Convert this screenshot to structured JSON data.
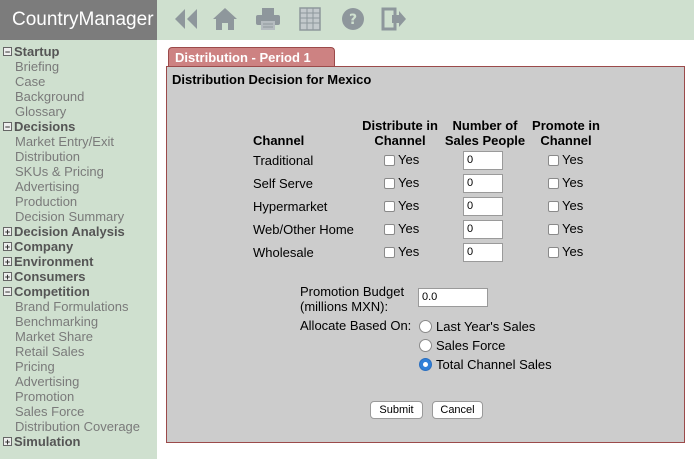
{
  "brand": "CountryManager",
  "toolbar": [
    {
      "name": "back-icon"
    },
    {
      "name": "home-icon"
    },
    {
      "name": "print-icon"
    },
    {
      "name": "spreadsheet-icon"
    },
    {
      "name": "help-icon"
    },
    {
      "name": "exit-icon"
    }
  ],
  "sidebar": {
    "rows": [
      {
        "type": "section",
        "label": "Startup",
        "toggle": "−"
      },
      {
        "type": "link",
        "label": "Briefing"
      },
      {
        "type": "link",
        "label": "Case"
      },
      {
        "type": "link",
        "label": "Background"
      },
      {
        "type": "link",
        "label": "Glossary"
      },
      {
        "type": "section",
        "label": "Decisions",
        "toggle": "−"
      },
      {
        "type": "link",
        "label": "Market Entry/Exit"
      },
      {
        "type": "link",
        "label": "Distribution"
      },
      {
        "type": "link",
        "label": "SKUs & Pricing"
      },
      {
        "type": "link",
        "label": "Advertising"
      },
      {
        "type": "link",
        "label": "Production"
      },
      {
        "type": "link",
        "label": "Decision Summary"
      },
      {
        "type": "section",
        "label": "Decision Analysis",
        "toggle": "+"
      },
      {
        "type": "section",
        "label": "Company",
        "toggle": "+"
      },
      {
        "type": "section",
        "label": "Environment",
        "toggle": "+"
      },
      {
        "type": "section",
        "label": "Consumers",
        "toggle": "+"
      },
      {
        "type": "section",
        "label": "Competition",
        "toggle": "−"
      },
      {
        "type": "link",
        "label": "Brand Formulations"
      },
      {
        "type": "link",
        "label": "Benchmarking"
      },
      {
        "type": "link",
        "label": "Market Share"
      },
      {
        "type": "link",
        "label": "Retail Sales"
      },
      {
        "type": "link",
        "label": "Pricing"
      },
      {
        "type": "link",
        "label": "Advertising"
      },
      {
        "type": "link",
        "label": "Promotion"
      },
      {
        "type": "link",
        "label": "Sales Force"
      },
      {
        "type": "link",
        "label": "Distribution Coverage"
      },
      {
        "type": "section",
        "label": "Simulation",
        "toggle": "+"
      }
    ]
  },
  "tab": {
    "label": "Distribution - Period 1"
  },
  "panel": {
    "title": "Distribution Decision for Mexico",
    "headers": {
      "channel": "Channel",
      "distribute": "Distribute in Channel",
      "salespeople": "Number of Sales People",
      "promote": "Promote in Channel"
    },
    "yes_label": "Yes",
    "rows": [
      {
        "channel": "Traditional",
        "sales_people": "0"
      },
      {
        "channel": "Self Serve",
        "sales_people": "0"
      },
      {
        "channel": "Hypermarket",
        "sales_people": "0"
      },
      {
        "channel": "Web/Other Home",
        "sales_people": "0"
      },
      {
        "channel": "Wholesale",
        "sales_people": "0"
      }
    ],
    "budget_label_1": "Promotion Budget",
    "budget_label_2": "(millions MXN):",
    "budget_value": "0.0",
    "allocate_label": "Allocate Based On:",
    "allocate_options": [
      {
        "label": "Last Year's Sales",
        "selected": false
      },
      {
        "label": "Sales Force",
        "selected": false
      },
      {
        "label": "Total Channel Sales",
        "selected": true
      }
    ],
    "submit_label": "Submit",
    "cancel_label": "Cancel"
  }
}
